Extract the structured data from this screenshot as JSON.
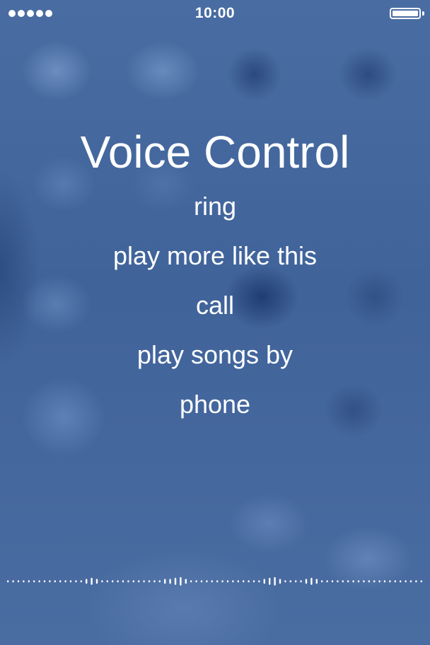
{
  "status_bar": {
    "signal_icon": "signal-strength-dots",
    "signal_bars": 5,
    "time": "10:00",
    "battery_icon": "battery-icon",
    "battery_level": 1.0
  },
  "voice_control": {
    "title": "Voice Control",
    "suggestions": [
      "ring",
      "play more like this",
      "call",
      "play songs by",
      "phone"
    ],
    "waveform_icon": "audio-waveform"
  }
}
